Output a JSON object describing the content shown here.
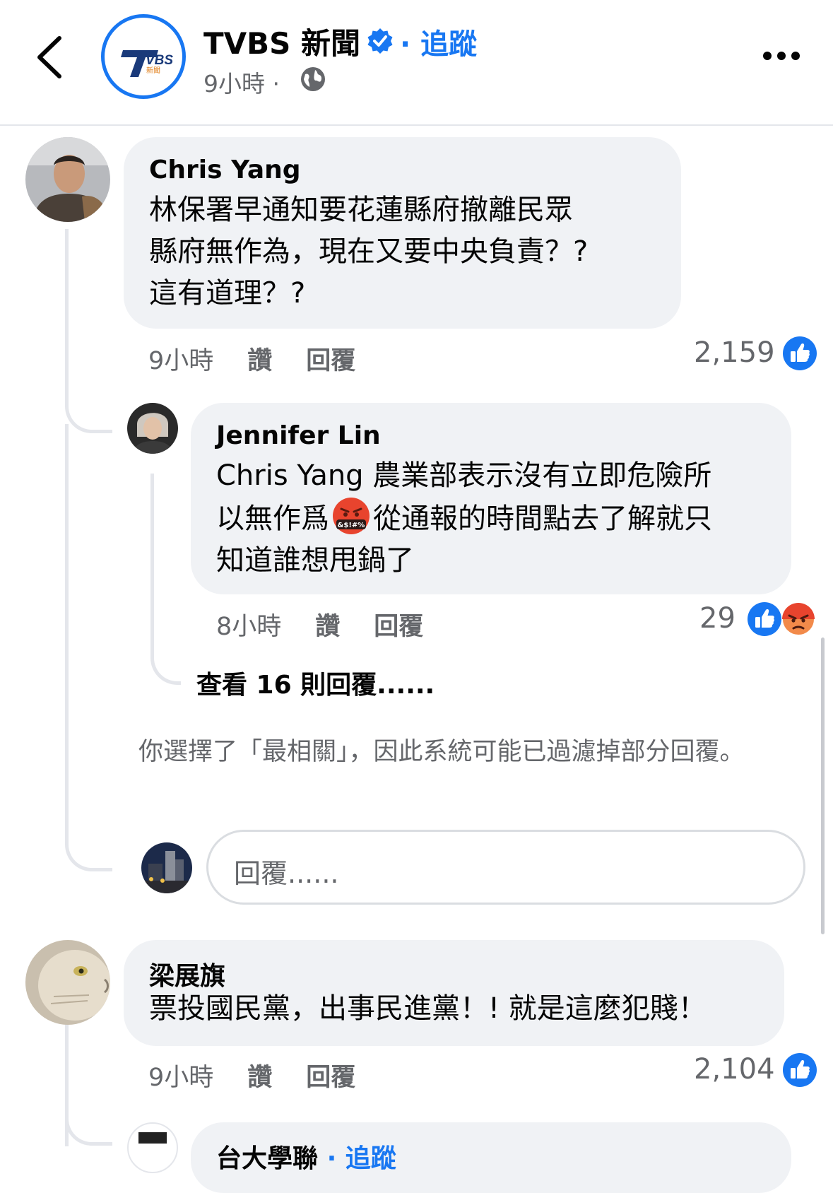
{
  "header": {
    "page_name": "TVBS 新聞",
    "follow_label": "· 追蹤",
    "post_time": "9小時 ·",
    "logo_text": "TVBS 新聞",
    "colors": {
      "accent": "#1877f2",
      "secondary_text": "#65676b",
      "bubble": "#f0f2f5"
    },
    "icons": [
      "back-arrow-icon",
      "verified-badge-icon",
      "globe-icon",
      "more-options-icon"
    ]
  },
  "comments": [
    {
      "author": "Chris Yang",
      "lines": [
        "林保署早通知要花蓮縣府撤離民眾",
        "縣府無作為，現在又要中央負責？?",
        "這有道理？?"
      ],
      "time": "9小時",
      "like_label": "讚",
      "reply_label": "回覆",
      "reaction_count": "2,159",
      "reactions": [
        "like-icon"
      ]
    },
    {
      "author": "Jennifer Lin",
      "lines": [
        "Chris Yang 農業部表示沒有立即危險所",
        "以無作爲",
        "從通報的時間點去了解就只",
        "知道誰想甩鍋了"
      ],
      "emoji_text": "&$!#%",
      "time": "8小時",
      "like_label": "讚",
      "reply_label": "回覆",
      "reaction_count": "29",
      "reactions": [
        "like-icon",
        "angry-icon"
      ]
    },
    {
      "author": "梁展旗",
      "lines": [
        "票投國民黨，出事民進黨！! 就是這麼犯賤！"
      ],
      "time": "9小時",
      "like_label": "讚",
      "reply_label": "回覆",
      "reaction_count": "2,104",
      "reactions": [
        "like-icon"
      ]
    }
  ],
  "view_replies": "查看 16 則回覆......",
  "filter_note": "你選擇了「最相關」，因此系統可能已過濾掉部分回覆。",
  "reply_box": {
    "placeholder": "回覆......"
  },
  "partial_next": {
    "author": "台大學聯",
    "follow_label": "· 追蹤"
  }
}
